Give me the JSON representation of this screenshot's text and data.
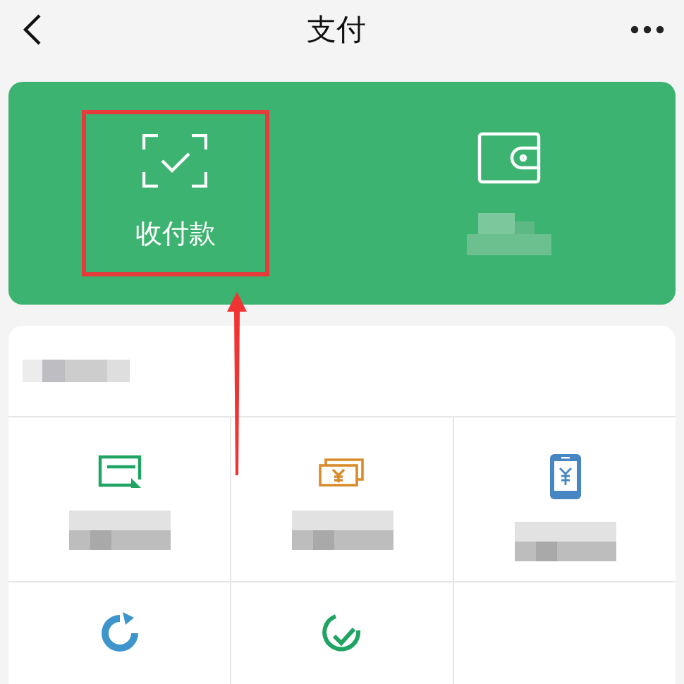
{
  "header": {
    "title": "支付"
  },
  "top_card": {
    "tiles": [
      {
        "kind": "scan",
        "label": "收付款",
        "highlighted": true
      },
      {
        "kind": "wallet",
        "highlighted": false,
        "blurred": true
      }
    ]
  },
  "services": {
    "rows": [
      [
        {
          "kind": "card"
        },
        {
          "kind": "money"
        },
        {
          "kind": "phone"
        }
      ],
      [
        {
          "kind": "fish"
        },
        {
          "kind": "check"
        },
        {
          "kind": "none"
        }
      ]
    ]
  }
}
